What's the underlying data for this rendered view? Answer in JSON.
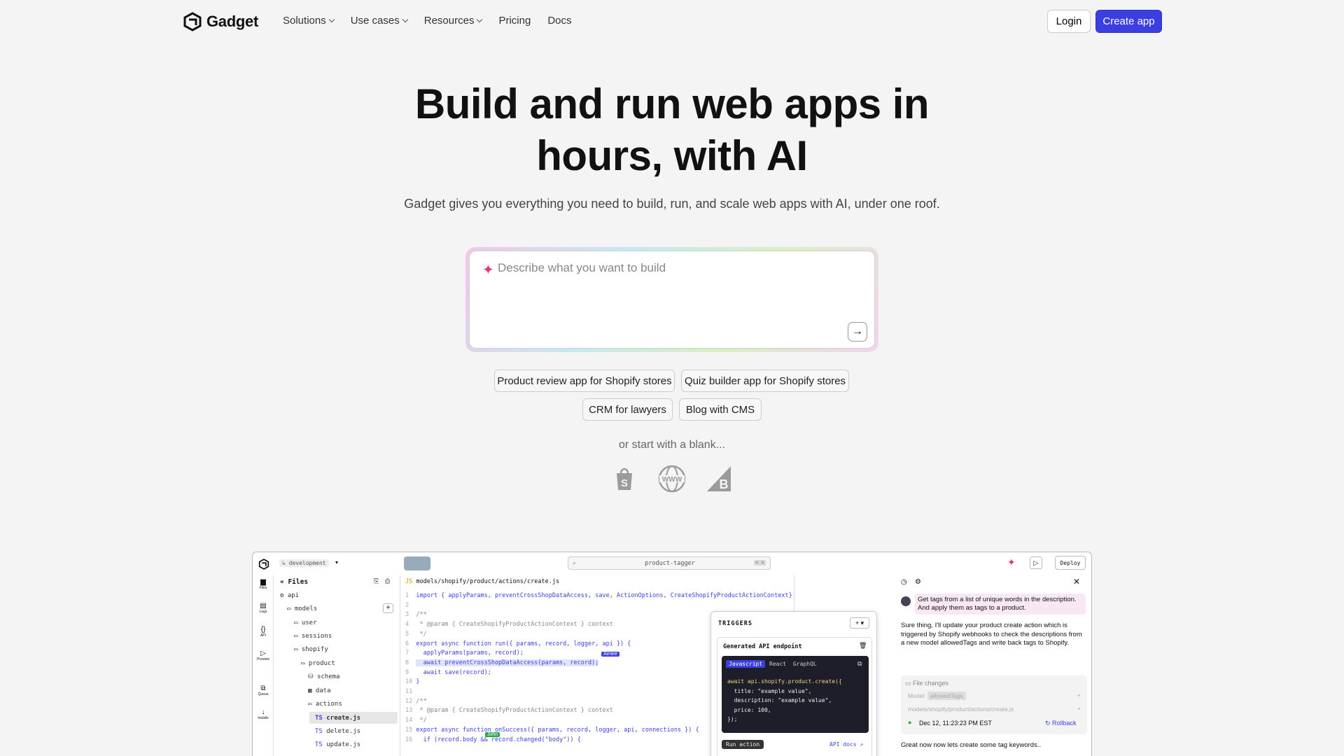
{
  "nav": {
    "brand": "Gadget",
    "items": [
      {
        "label": "Solutions",
        "dropdown": true
      },
      {
        "label": "Use cases",
        "dropdown": true
      },
      {
        "label": "Resources",
        "dropdown": true
      },
      {
        "label": "Pricing",
        "dropdown": false
      },
      {
        "label": "Docs",
        "dropdown": false
      }
    ],
    "login": "Login",
    "create": "Create app"
  },
  "hero": {
    "line1": "Build and run web apps in",
    "line2": "hours, with AI",
    "subtitle": "Gadget gives you everything you need to build, run, and scale web apps with AI, under one roof."
  },
  "prompt": {
    "placeholder": "Describe what you want to build"
  },
  "suggestions": [
    "Product review app for Shopify stores",
    "Quiz builder app for Shopify stores",
    "CRM for lawyers",
    "Blog with CMS"
  ],
  "blank": {
    "label": "or start with a blank...",
    "icons": [
      "shopify-icon",
      "www-icon",
      "bigcommerce-icon"
    ]
  },
  "editor": {
    "env": "development",
    "search": "product-tagger",
    "shortcut": "⌘ K",
    "deploy": "Deploy",
    "sidebar": [
      "Files",
      "Logs",
      "API",
      "Preview",
      "Queue",
      "Installs"
    ],
    "files_title": "Files",
    "tree": [
      "api",
      "models",
      "user",
      "sessions",
      "shopify",
      "product",
      "schema",
      "data",
      "actions",
      "create.js",
      "delete.js",
      "update.js"
    ],
    "path": "models/shopify/product/actions/create.js",
    "code": [
      "import { applyParams, preventCrossShopDataAccess, save, ActionOptions, CreateShopifyProductActionContext} from \"gadget-server\";",
      "",
      "/**",
      " * @param { CreateShopifyProductActionContext } context",
      " */",
      "export async function run({ params, record, logger, api }) {",
      "  applyParams(params, record);",
      "  await preventCrossShopDataAccess(params, record);",
      "  await save(record);",
      "}",
      "",
      "/**",
      " * @param { CreateShopifyProductActionContext } context",
      " */",
      "export async function onSuccess({ params, record, logger, api, connections }) {",
      "  if (record.body && record.changed(\"body\")) {"
    ],
    "cursor_aimee": "Aimee",
    "cursor_john": "John",
    "triggers": {
      "title": "TRIGGERS",
      "card_title": "Generated API endpoint",
      "tabs": [
        "Javascript",
        "React",
        "GraphQL"
      ],
      "code": [
        "await api.shopify.product.create({",
        "  title: \"example value\",",
        "  description: \"example value\",",
        "  price: 100,",
        "});"
      ],
      "run_btn": "Run action",
      "docs": "API docs"
    },
    "chat": {
      "user_msg": "Get tags from a list of unique words in the description. And apply them as tags to a product.",
      "ai_msg": "Sure thing, I'll update your product create action which is triggered by Shopify webhooks to check the descriptions from a new model allowedTags and write back tags to Shopify.",
      "changes_title": "File changes",
      "model_label": "Model:",
      "model_value": "allowedTags",
      "file": "models/shopify/product/actions/create.js",
      "timestamp": "Dec 12, 11:23:23 PM EST",
      "rollback": "Rollback",
      "followup": "Great now now lets create some tag keywords.."
    }
  }
}
